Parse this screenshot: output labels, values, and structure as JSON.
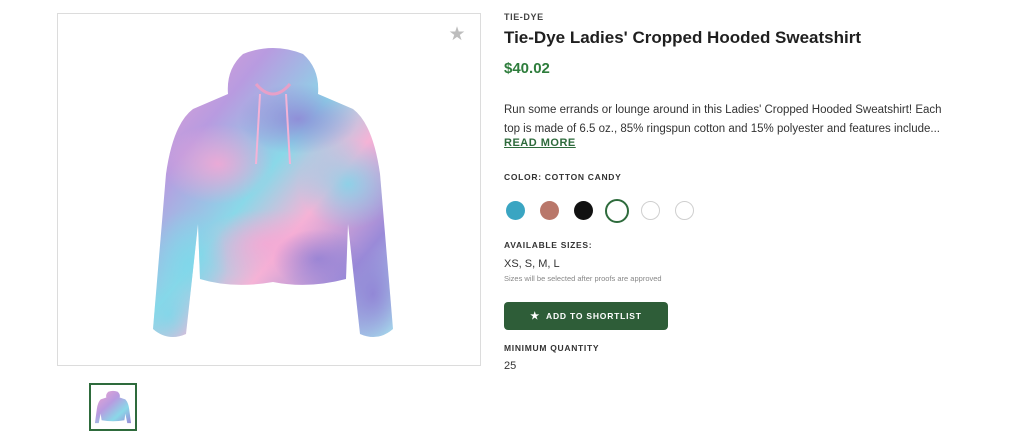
{
  "product": {
    "category": "TIE-DYE",
    "title": "Tie-Dye Ladies' Cropped Hooded Sweatshirt",
    "price": "$40.02",
    "description_lines": [
      "Run some errands or lounge around in this Ladies' Cropped Hooded Sweatshirt! Each",
      "top is made of 6.5 oz., 85% ringspun cotton and 15% polyester and features include..."
    ],
    "read_more": "READ MORE",
    "favorite_icon": "star-icon",
    "image_alt": "tie-dye cropped hoodie in pink, purple and blue"
  },
  "color": {
    "label": "COLOR: COTTON CANDY",
    "swatches": [
      {
        "name": "teal",
        "hex": "#3aa5c2",
        "selected": false
      },
      {
        "name": "rose-brown",
        "hex": "#b9776a",
        "selected": false
      },
      {
        "name": "black",
        "hex": "#111111",
        "selected": false
      },
      {
        "name": "cotton-candy",
        "hex": "#ffffff",
        "selected": true
      },
      {
        "name": "white",
        "hex": "#ffffff",
        "selected": false
      },
      {
        "name": "white-2",
        "hex": "#ffffff",
        "selected": false
      }
    ]
  },
  "sizes": {
    "label": "AVAILABLE SIZES:",
    "value": "XS, S, M, L",
    "note": "Sizes will be selected after proofs are approved"
  },
  "actions": {
    "shortlist_label": "ADD TO SHORTLIST",
    "shortlist_icon": "star-icon"
  },
  "minimum": {
    "label": "MINIMUM QUANTITY",
    "value": "25"
  },
  "colors": {
    "accent": "#2e6b3c",
    "price": "#2e7d3c",
    "button": "#2e5d38"
  }
}
